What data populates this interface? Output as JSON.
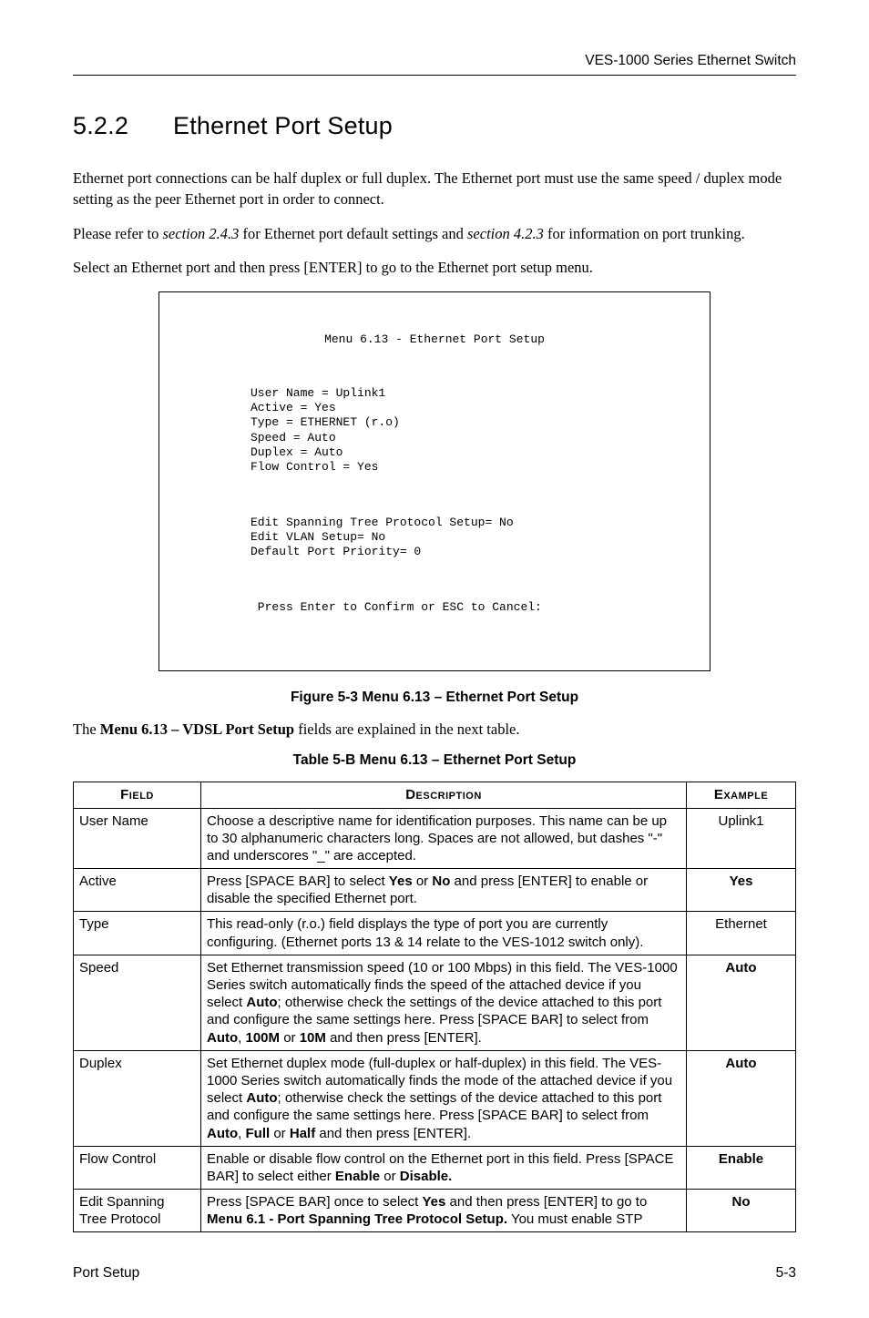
{
  "header": {
    "product": "VES-1000 Series Ethernet Switch"
  },
  "section": {
    "number": "5.2.2",
    "title": "Ethernet Port Setup"
  },
  "paragraphs": {
    "p1": "Ethernet port connections can be half duplex or full duplex. The Ethernet port must use the same speed / duplex mode setting as the peer Ethernet port in order to connect.",
    "p2a": "Please refer to ",
    "p2b": "section 2.4.3",
    "p2c": " for Ethernet port default settings and ",
    "p2d": "section 4.2.3",
    "p2e": " for information on port trunking.",
    "p3": "Select an Ethernet port and then press [ENTER] to go to the Ethernet port setup menu.",
    "p4a": "The ",
    "p4b": "Menu 6.13 – VDSL Port Setup",
    "p4c": " fields are explained in the next table."
  },
  "terminal": {
    "title": "Menu 6.13 - Ethernet Port Setup",
    "lines_block1": "User Name = Uplink1\nActive = Yes\nType = ETHERNET (r.o)\nSpeed = Auto\nDuplex = Auto\nFlow Control = Yes",
    "lines_block2": "Edit Spanning Tree Protocol Setup= No\nEdit VLAN Setup= No\nDefault Port Priority= 0",
    "prompt": " Press Enter to Confirm or ESC to Cancel:"
  },
  "figure_caption": "Figure 5-3 Menu 6.13 – Ethernet Port Setup",
  "table_caption": "Table 5-B Menu 6.13 – Ethernet Port Setup",
  "table": {
    "headers": {
      "field": "Field",
      "description": "Description",
      "example": "Example"
    },
    "rows": [
      {
        "field": "User Name",
        "desc": [
          {
            "t": "Choose a descriptive name for identification purposes. This name can be up to 30 alphanumeric characters long. Spaces are not allowed, but dashes \"-\" and underscores \"_\" are accepted."
          }
        ],
        "example": "Uplink1",
        "example_bold": false
      },
      {
        "field": "Active",
        "desc": [
          {
            "t": "Press [SPACE BAR] to select "
          },
          {
            "t": "Yes",
            "b": true
          },
          {
            "t": " or "
          },
          {
            "t": "No",
            "b": true
          },
          {
            "t": " and press [ENTER] to enable or disable the specified Ethernet port."
          }
        ],
        "example": "Yes",
        "example_bold": true
      },
      {
        "field": "Type",
        "desc": [
          {
            "t": "This read-only (r.o.) field displays the type of port you are currently configuring.  (Ethernet ports 13 & 14 relate to the VES-1012 switch only)."
          }
        ],
        "example": "Ethernet",
        "example_bold": false
      },
      {
        "field": "Speed",
        "desc": [
          {
            "t": "Set Ethernet transmission speed (10 or 100 Mbps) in this field. The VES-1000 Series switch automatically finds the speed of the attached device if you select "
          },
          {
            "t": "Auto",
            "b": true
          },
          {
            "t": "; otherwise check the settings of the device attached to this port and configure the same settings here. Press [SPACE BAR] to select from "
          },
          {
            "t": "Auto",
            "b": true
          },
          {
            "t": ", "
          },
          {
            "t": "100M",
            "b": true
          },
          {
            "t": " or "
          },
          {
            "t": "10M",
            "b": true
          },
          {
            "t": " and then press [ENTER]."
          }
        ],
        "example": "Auto",
        "example_bold": true
      },
      {
        "field": "Duplex",
        "desc": [
          {
            "t": "Set Ethernet duplex mode (full-duplex or half-duplex) in this field. The VES-1000 Series switch automatically finds the mode of the attached device if you select "
          },
          {
            "t": "Auto",
            "b": true
          },
          {
            "t": "; otherwise check the settings of the device attached to this port and configure the same settings here. Press [SPACE BAR] to select from "
          },
          {
            "t": "Auto",
            "b": true
          },
          {
            "t": ", "
          },
          {
            "t": "Full",
            "b": true
          },
          {
            "t": " or "
          },
          {
            "t": "Half",
            "b": true
          },
          {
            "t": " and then press [ENTER]."
          }
        ],
        "example": "Auto",
        "example_bold": true
      },
      {
        "field": "Flow Control",
        "desc": [
          {
            "t": "Enable or disable flow control on the Ethernet port in this field. Press [SPACE BAR] to select either "
          },
          {
            "t": "Enable",
            "b": true
          },
          {
            "t": " or "
          },
          {
            "t": "Disable.",
            "b": true
          }
        ],
        "example": "Enable",
        "example_bold": true
      },
      {
        "field": "Edit Spanning Tree Protocol",
        "desc": [
          {
            "t": "Press [SPACE BAR] once to select "
          },
          {
            "t": "Yes",
            "b": true
          },
          {
            "t": " and then press [ENTER] to go to "
          },
          {
            "t": "Menu 6.1 - Port Spanning Tree Protocol Setup.",
            "b": true
          },
          {
            "t": " You must enable STP"
          }
        ],
        "example": "No",
        "example_bold": true
      }
    ]
  },
  "footer": {
    "left": "Port Setup",
    "right": "5-3"
  }
}
